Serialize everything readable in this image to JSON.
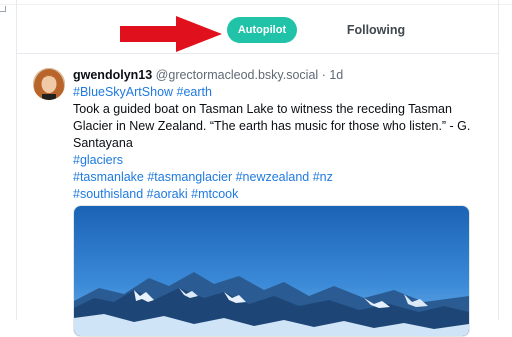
{
  "tabs": {
    "autopilot": "Autopilot",
    "following": "Following"
  },
  "post": {
    "author": "gwendolyn13",
    "handle": "@grectormacleod.bsky.social",
    "separator": "·",
    "time": "1d",
    "tags_line1": "#BlueSkyArtShow #earth",
    "body": "Took a guided boat on Tasman Lake to witness the receding Tasman Glacier in New Zealand. “The earth has music for those who listen.” - G. Santayana",
    "tags_line2": "#glaciers",
    "tags_line3": "#tasmanlake #tasmanglacier #newzealand #nz",
    "tags_line4": "#southisland #aoraki #mtcook"
  },
  "colors": {
    "accent": "#21c3a8",
    "link": "#1f7ae0",
    "arrow": "#e0101c"
  },
  "icons": {
    "annotation": "red-arrow-icon",
    "image": "glacier-mountain-photo"
  }
}
